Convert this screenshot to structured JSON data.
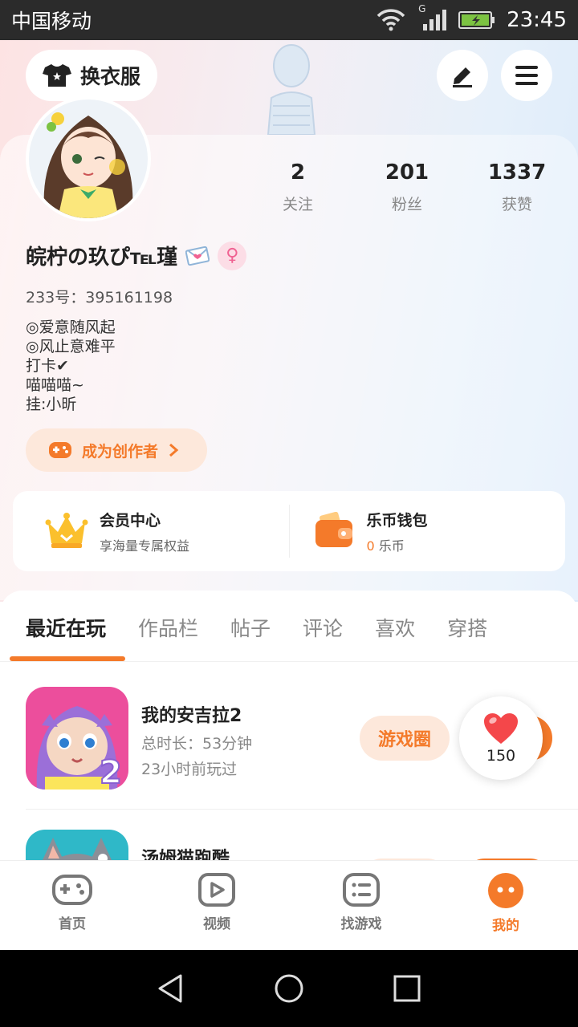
{
  "status_bar": {
    "carrier": "中国移动",
    "network": "G",
    "time": "23:45"
  },
  "header": {
    "wardrobe_label": "换衣服",
    "edit_icon": "pen-icon",
    "menu_icon": "menu-icon"
  },
  "profile": {
    "stats": [
      {
        "value": "2",
        "label": "关注"
      },
      {
        "value": "201",
        "label": "粉丝"
      },
      {
        "value": "1337",
        "label": "获赞"
      }
    ],
    "username": "皖柠の玖ぴ℡瑾",
    "gender_symbol": "♀",
    "uid": "233号：395161198",
    "bio": [
      "◎爱意随风起",
      "◎风止意难平",
      "打卡✔",
      "喵喵喵~",
      "挂:小昕"
    ],
    "creator_label": "成为创作者"
  },
  "member": {
    "vip_title": "会员中心",
    "vip_sub": "享海量专属权益",
    "wallet_title": "乐币钱包",
    "wallet_amount": "0",
    "wallet_unit": "乐币"
  },
  "tabs": [
    "最近在玩",
    "作品栏",
    "帖子",
    "评论",
    "喜欢",
    "穿搭"
  ],
  "games": [
    {
      "name": "我的安吉拉2",
      "time": "总时长：53分钟",
      "last": "23小时前玩过",
      "circle_label": "游戏圈"
    },
    {
      "name": "汤姆猫跑酷"
    }
  ],
  "like_bubble": {
    "count": "150"
  },
  "bottom_nav": [
    {
      "label": "首页",
      "icon": "gamepad-icon"
    },
    {
      "label": "视频",
      "icon": "video-icon"
    },
    {
      "label": "找游戏",
      "icon": "list-icon"
    },
    {
      "label": "我的",
      "icon": "profile-face-icon"
    }
  ],
  "colors": {
    "accent": "#f47a2a",
    "accent_light": "#fde8db"
  }
}
